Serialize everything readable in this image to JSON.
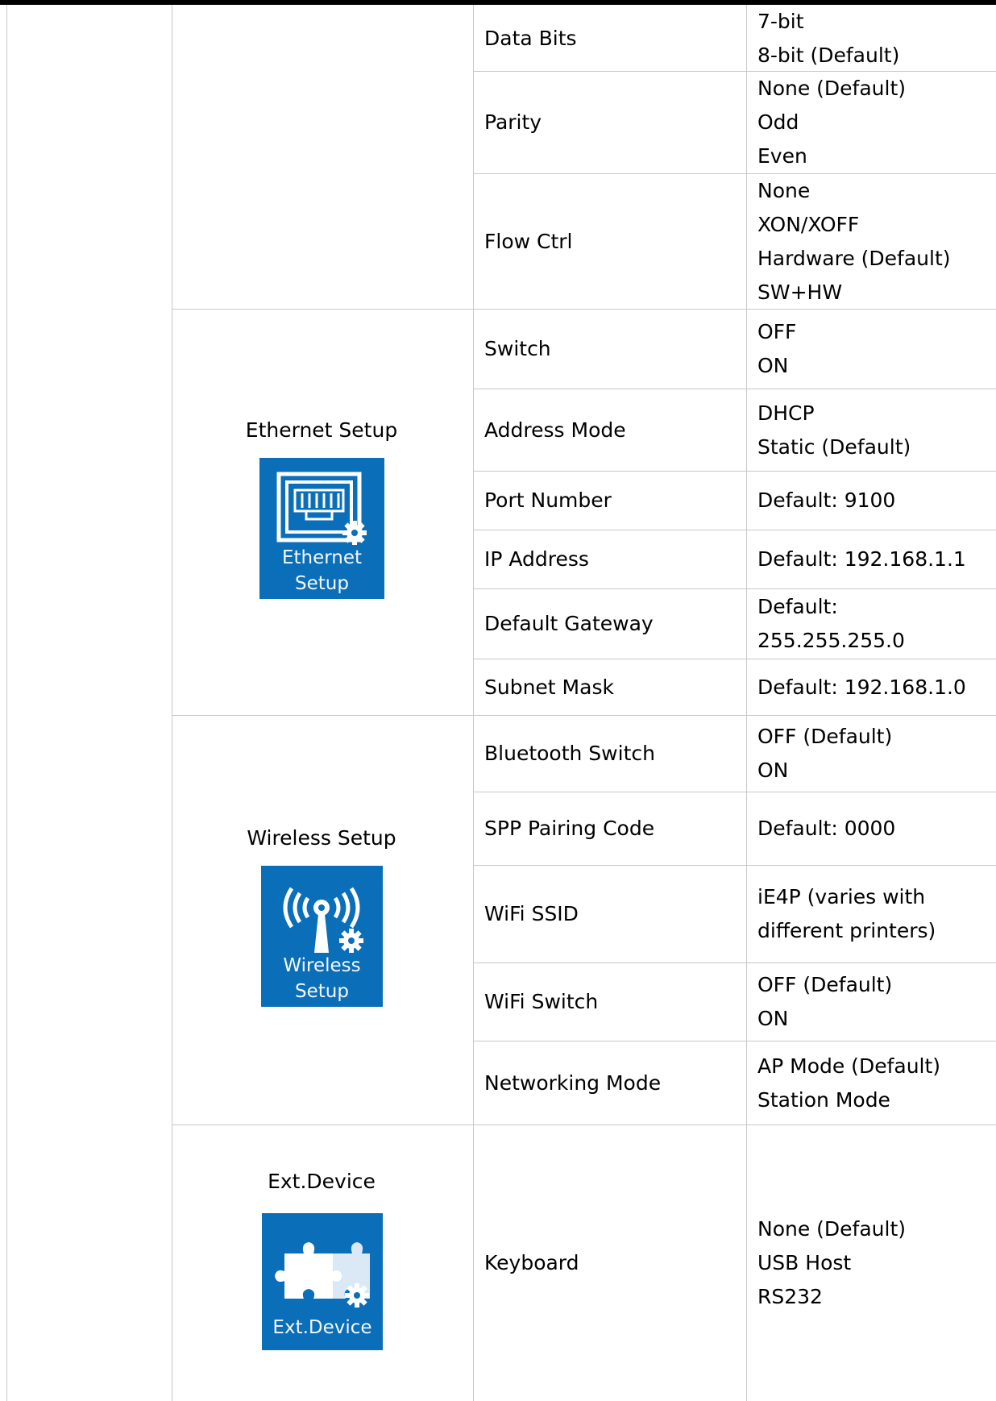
{
  "rows": [
    {
      "setting": "Data Bits",
      "options": [
        "7-bit",
        "8-bit (Default)"
      ]
    },
    {
      "setting": "Parity",
      "options": [
        "None (Default)",
        "Odd",
        "Even"
      ]
    },
    {
      "setting": "Flow Ctrl",
      "options": [
        "None",
        "XON/XOFF",
        "Hardware (Default)",
        "SW+HW"
      ]
    },
    {
      "setting": "Switch",
      "options": [
        "OFF",
        "ON"
      ]
    },
    {
      "setting": "Address Mode",
      "options": [
        "DHCP",
        "Static (Default)"
      ]
    },
    {
      "setting": "Port Number",
      "options": [
        "Default: 9100"
      ]
    },
    {
      "setting": "IP Address",
      "options": [
        "Default: 192.168.1.1"
      ]
    },
    {
      "setting": "Default Gateway",
      "options": [
        "Default:",
        "255.255.255.0"
      ]
    },
    {
      "setting": "Subnet Mask",
      "options": [
        "Default: 192.168.1.0"
      ]
    },
    {
      "setting": "Bluetooth Switch",
      "options": [
        "OFF (Default)",
        "ON"
      ]
    },
    {
      "setting": "SPP Pairing Code",
      "options": [
        "Default: 0000"
      ]
    },
    {
      "setting": "WiFi SSID",
      "options": [
        "iE4P (varies with",
        "different printers)"
      ]
    },
    {
      "setting": "WiFi Switch",
      "options": [
        "OFF (Default)",
        "ON"
      ]
    },
    {
      "setting": "Networking Mode",
      "options": [
        "AP Mode (Default)",
        "Station Mode"
      ]
    },
    {
      "setting": "Keyboard",
      "options": [
        "None (Default)",
        "USB Host",
        "RS232"
      ]
    }
  ],
  "sections": [
    {
      "label": "Ethernet Setup",
      "icon": "ethernet-setup-icon",
      "icon_caption": [
        "Ethernet",
        "Setup"
      ]
    },
    {
      "label": "Wireless Setup",
      "icon": "wireless-setup-icon",
      "icon_caption": [
        "Wireless",
        "Setup"
      ]
    },
    {
      "label": "Ext.Device",
      "icon": "ext-device-icon",
      "icon_caption": [
        "Ext.Device"
      ]
    }
  ],
  "colors": {
    "icon_background": "#0a6eb8",
    "grid_line": "#c8c8c8",
    "text": "#000000"
  }
}
